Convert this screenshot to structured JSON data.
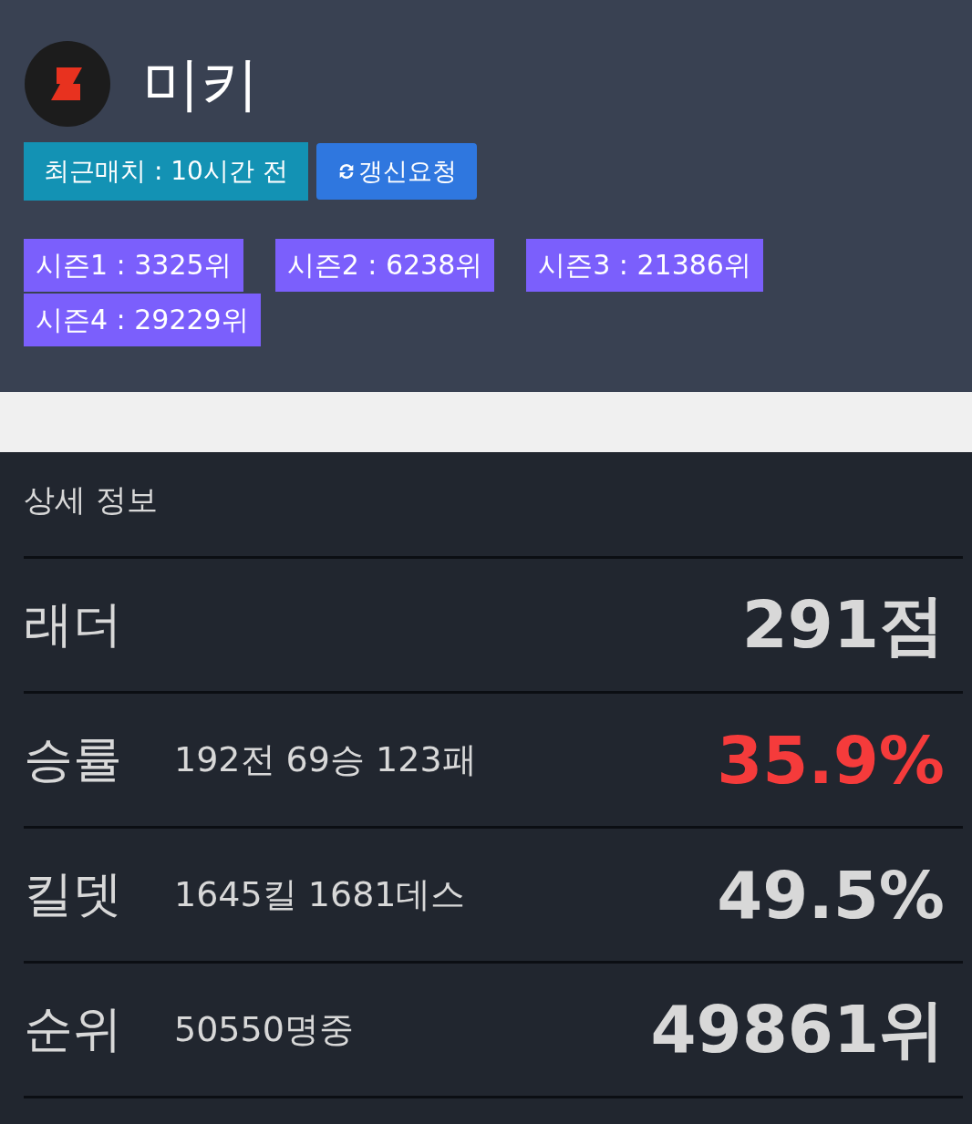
{
  "profile": {
    "name": "미키",
    "last_match": "최근매치 : 10시간 전",
    "refresh_button": "갱신요청"
  },
  "seasons": [
    "시즌1 : 3325위",
    "시즌2 : 6238위",
    "시즌3 : 21386위",
    "시즌4 : 29229위"
  ],
  "details": {
    "title": "상세 정보",
    "rows": [
      {
        "label": "래더",
        "detail": "",
        "value": "291점",
        "highlight": false
      },
      {
        "label": "승률",
        "detail": "192전 69승 123패",
        "value": "35.9%",
        "highlight": true
      },
      {
        "label": "킬뎃",
        "detail": "1645킬 1681데스",
        "value": "49.5%",
        "highlight": false
      },
      {
        "label": "순위",
        "detail": "50550명중",
        "value": "49861위",
        "highlight": false
      }
    ]
  }
}
